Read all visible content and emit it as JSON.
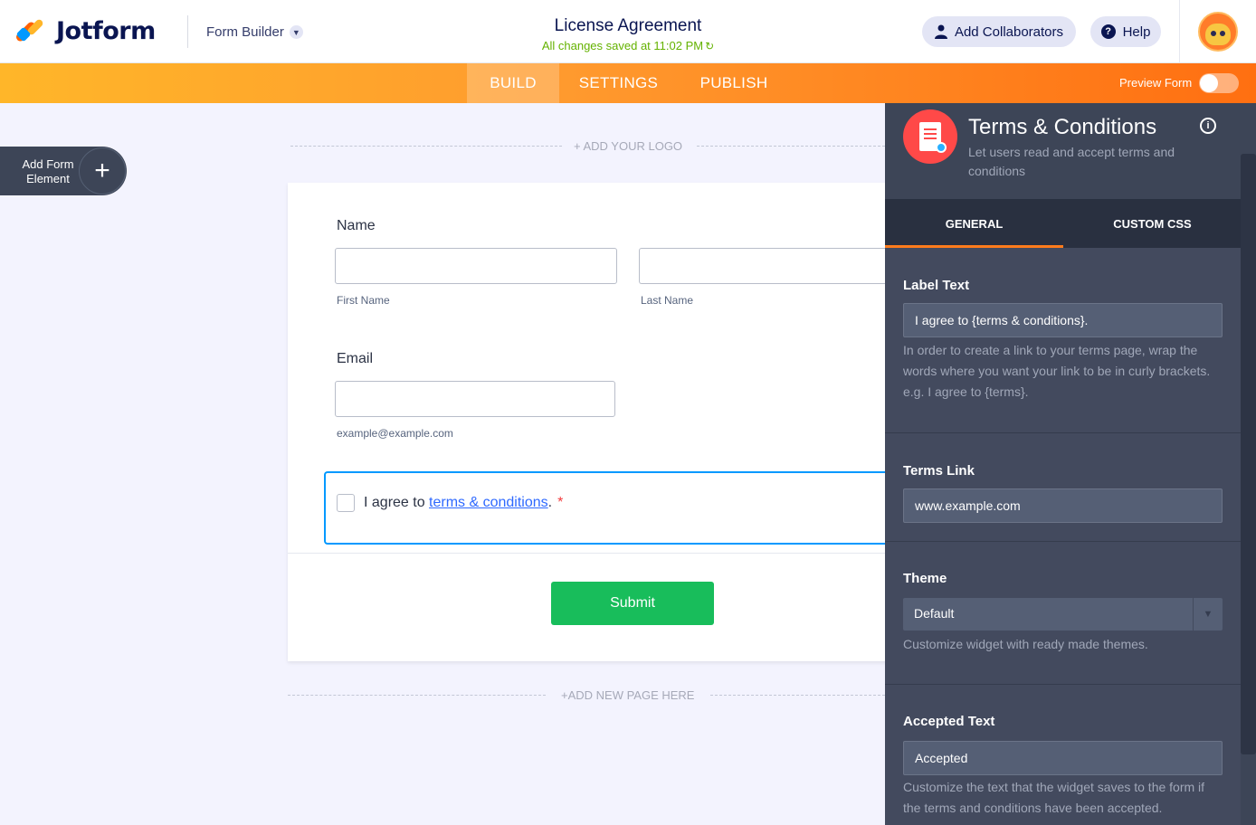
{
  "app": {
    "brand": "Jotform",
    "mode_label": "Form Builder",
    "form_title": "License Agreement",
    "save_status": "All changes saved at 11:02 PM"
  },
  "header": {
    "collaborators_label": "Add Collaborators",
    "help_label": "Help"
  },
  "nav": {
    "tabs": [
      {
        "label": "BUILD",
        "active": true
      },
      {
        "label": "SETTINGS",
        "active": false
      },
      {
        "label": "PUBLISH",
        "active": false
      }
    ],
    "preview_label": "Preview Form",
    "preview_on": false
  },
  "canvas": {
    "add_element_label": "Add Form Element",
    "add_logo": "+ ADD YOUR LOGO",
    "add_page": "+ADD NEW PAGE HERE"
  },
  "form": {
    "name_label": "Name",
    "first_name_sub": "First Name",
    "last_name_sub": "Last Name",
    "email_label": "Email",
    "email_sub": "example@example.com",
    "terms_prefix": "I agree to ",
    "terms_link": "terms & conditions",
    "terms_suffix": ".",
    "required_mark": "*",
    "submit_label": "Submit"
  },
  "panel": {
    "title": "Terms & Conditions",
    "description": "Let users read and accept terms and conditions",
    "tabs": [
      {
        "label": "GENERAL",
        "active": true
      },
      {
        "label": "CUSTOM CSS",
        "active": false
      }
    ],
    "label_text": {
      "label": "Label Text",
      "value": "I agree to {terms & conditions}.",
      "help": "In order to create a link to your terms page, wrap the words where you want your link to be in curly brackets. e.g. I agree to {terms}."
    },
    "terms_link": {
      "label": "Terms Link",
      "value": "www.example.com"
    },
    "theme": {
      "label": "Theme",
      "value": "Default",
      "help": "Customize widget with ready made themes."
    },
    "accepted_text": {
      "label": "Accepted Text",
      "value": "Accepted",
      "help": "Customize the text that the widget saves to the form if the terms and conditions have been accepted."
    }
  },
  "colors": {
    "accent_orange": "#ff6f11",
    "submit_green": "#18bd5b",
    "link_blue": "#2e69ff",
    "panel_bg": "#434a5e"
  }
}
